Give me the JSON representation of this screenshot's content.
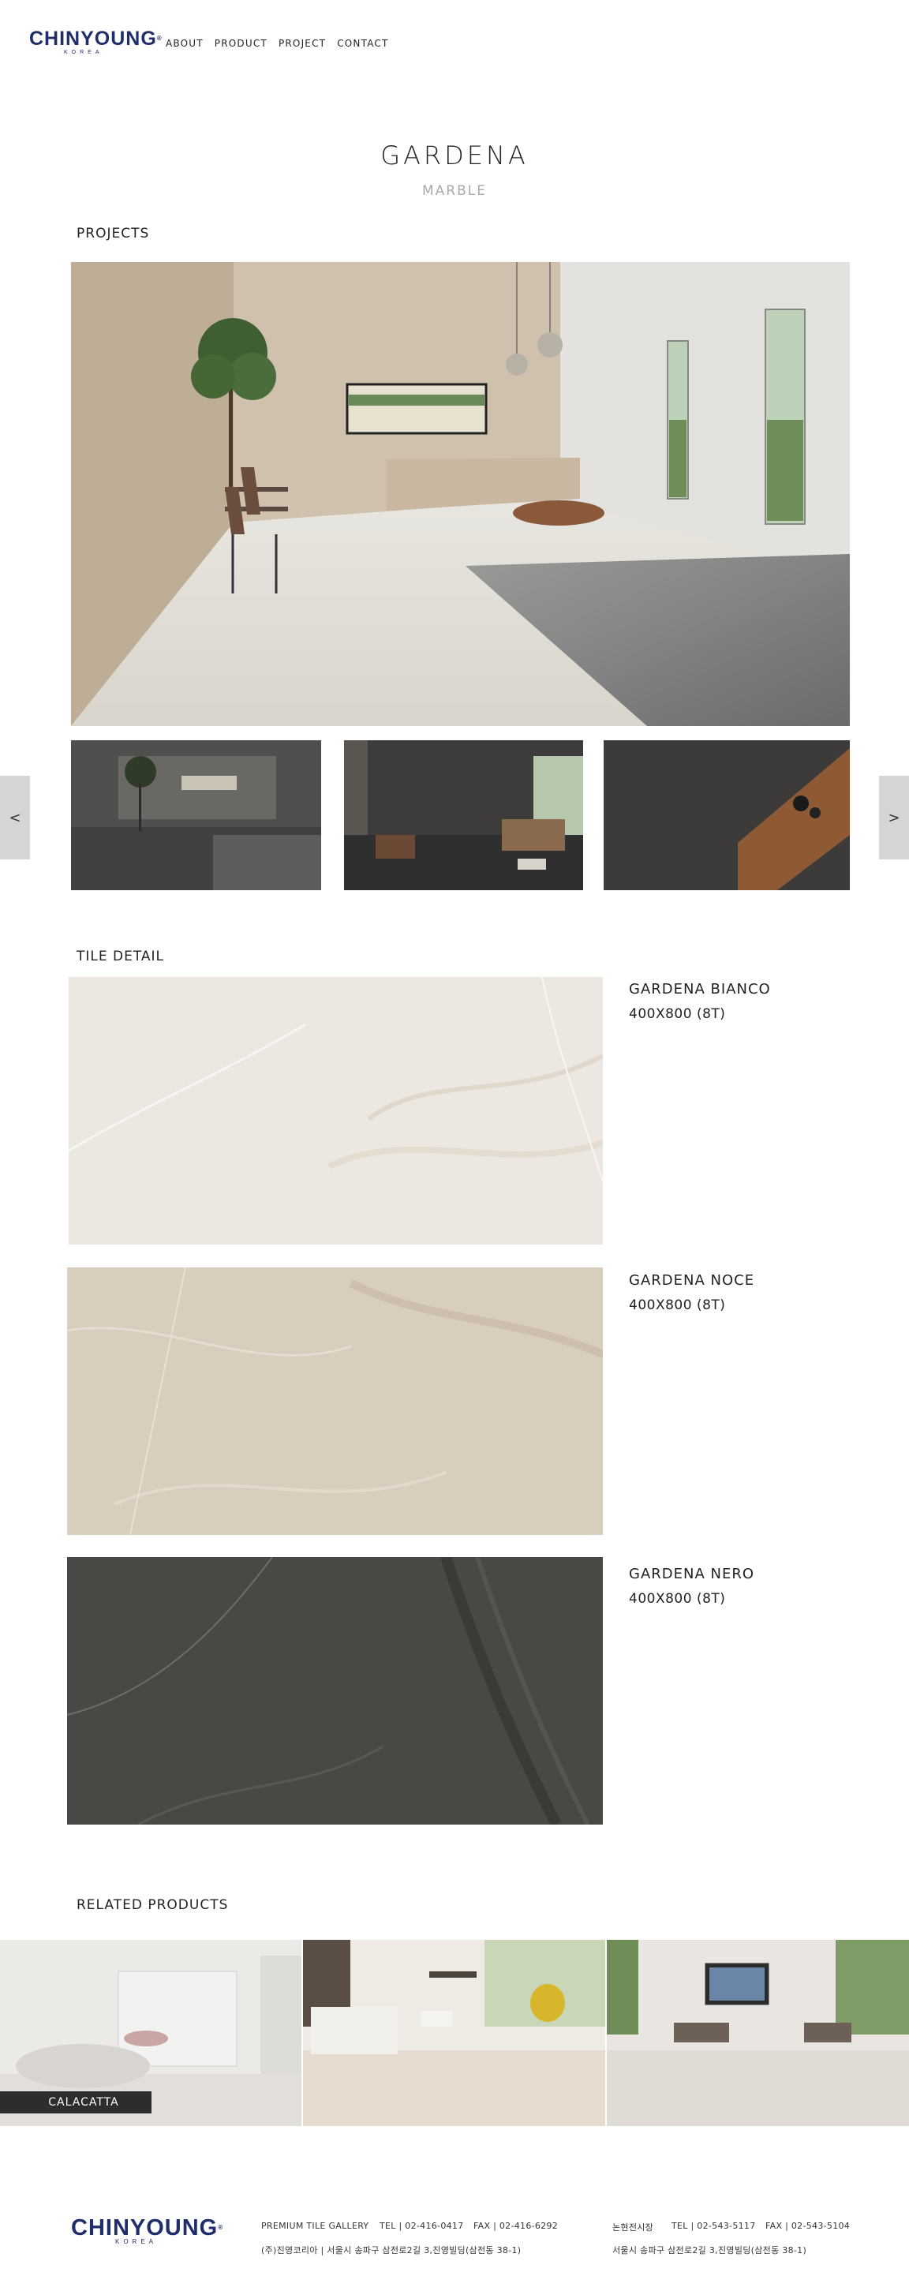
{
  "header": {
    "logo_text_a": "CHIN",
    "logo_text_b": "YOUNG",
    "logo_sub": "KOREA",
    "nav": [
      "ABOUT",
      "PRODUCT",
      "PROJECT",
      "CONTACT"
    ]
  },
  "product": {
    "title": "GARDENA",
    "category": "MARBLE"
  },
  "projects": {
    "label": "PROJECTS",
    "prev_label": "<",
    "next_label": ">"
  },
  "tile_detail": {
    "label": "TILE DETAIL",
    "items": [
      {
        "name": "GARDENA BIANCO",
        "size": "400X800 (8T)",
        "color": "#ece8e1"
      },
      {
        "name": "GARDENA NOCE",
        "size": "400X800 (8T)",
        "color": "#d9cdbd"
      },
      {
        "name": "GARDENA NERO",
        "size": "400X800 (8T)",
        "color": "#4a4845"
      }
    ]
  },
  "related": {
    "label": "RELATED PRODUCTS",
    "items": [
      {
        "name": "CALACATTA"
      }
    ]
  },
  "footer": {
    "gallery_1": "PREMIUM TILE GALLERY",
    "tel_1": "TEL | 02-416-0417",
    "fax_1": "FAX | 02-416-6292",
    "addr_1": "(주)진영코리아 | 서울시 송파구 삼전로2길 3,진영빌딩(삼전동 38-1)",
    "gallery_2": "논현전시장",
    "tel_2": "TEL | 02-543-5117",
    "fax_2": "FAX | 02-543-5104",
    "addr_2": "서울시 송파구 삼전로2길 3,진영빌딩(삼전동 38-1)"
  },
  "colors": {
    "brand": "#1f2e6b",
    "muted": "#aaaaaa",
    "arrow_bg": "#d5d5d5"
  }
}
